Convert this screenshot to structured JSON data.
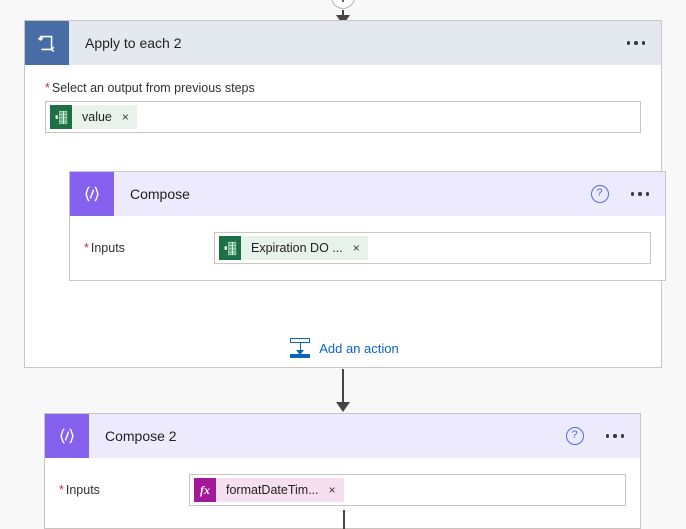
{
  "page": {
    "background": "#f8f8f8",
    "canvas_line_color": "#484644"
  },
  "connectors": {
    "top": {
      "icon": "plus-circle-icon",
      "has_arrow": true
    },
    "middle": {
      "has_arrow": true
    },
    "bottom": {
      "has_arrow": false
    }
  },
  "apply_to_each": {
    "title": "Apply to each 2",
    "icon": "loop-repeat-icon",
    "header_color": "#e4e8ef",
    "icon_color": "#486ca5",
    "more_menu_label": "...",
    "field": {
      "label": "Select an output from previous steps",
      "required": true,
      "token": {
        "text": "value",
        "icon": "excel-icon",
        "icon_color": "#1d7044",
        "chip_color": "#e7f2eb",
        "remove_label": "×"
      }
    },
    "compose": {
      "title": "Compose",
      "icon": "compose-braces-icon",
      "header_color": "#eeeafe",
      "icon_color": "#8661f0",
      "help_label": "?",
      "more_menu_label": "...",
      "inputs": {
        "label": "Inputs",
        "required": true,
        "token": {
          "text": "Expiration DO ...",
          "icon": "excel-icon",
          "icon_color": "#1d7044",
          "chip_color": "#e7f2eb",
          "remove_label": "×"
        }
      }
    },
    "add_action": {
      "label": "Add an action",
      "icon": "insert-below-icon",
      "color": "#0a65c2"
    }
  },
  "compose_2": {
    "title": "Compose 2",
    "icon": "compose-braces-icon",
    "header_color": "#eeeafe",
    "icon_color": "#8661f0",
    "help_label": "?",
    "more_menu_label": "...",
    "inputs": {
      "label": "Inputs",
      "required": true,
      "token": {
        "text": "formatDateTim...",
        "icon": "fx-icon",
        "icon_label": "fx",
        "icon_color": "#a4189a",
        "chip_color": "#f6e0ef",
        "remove_label": "×"
      }
    }
  }
}
